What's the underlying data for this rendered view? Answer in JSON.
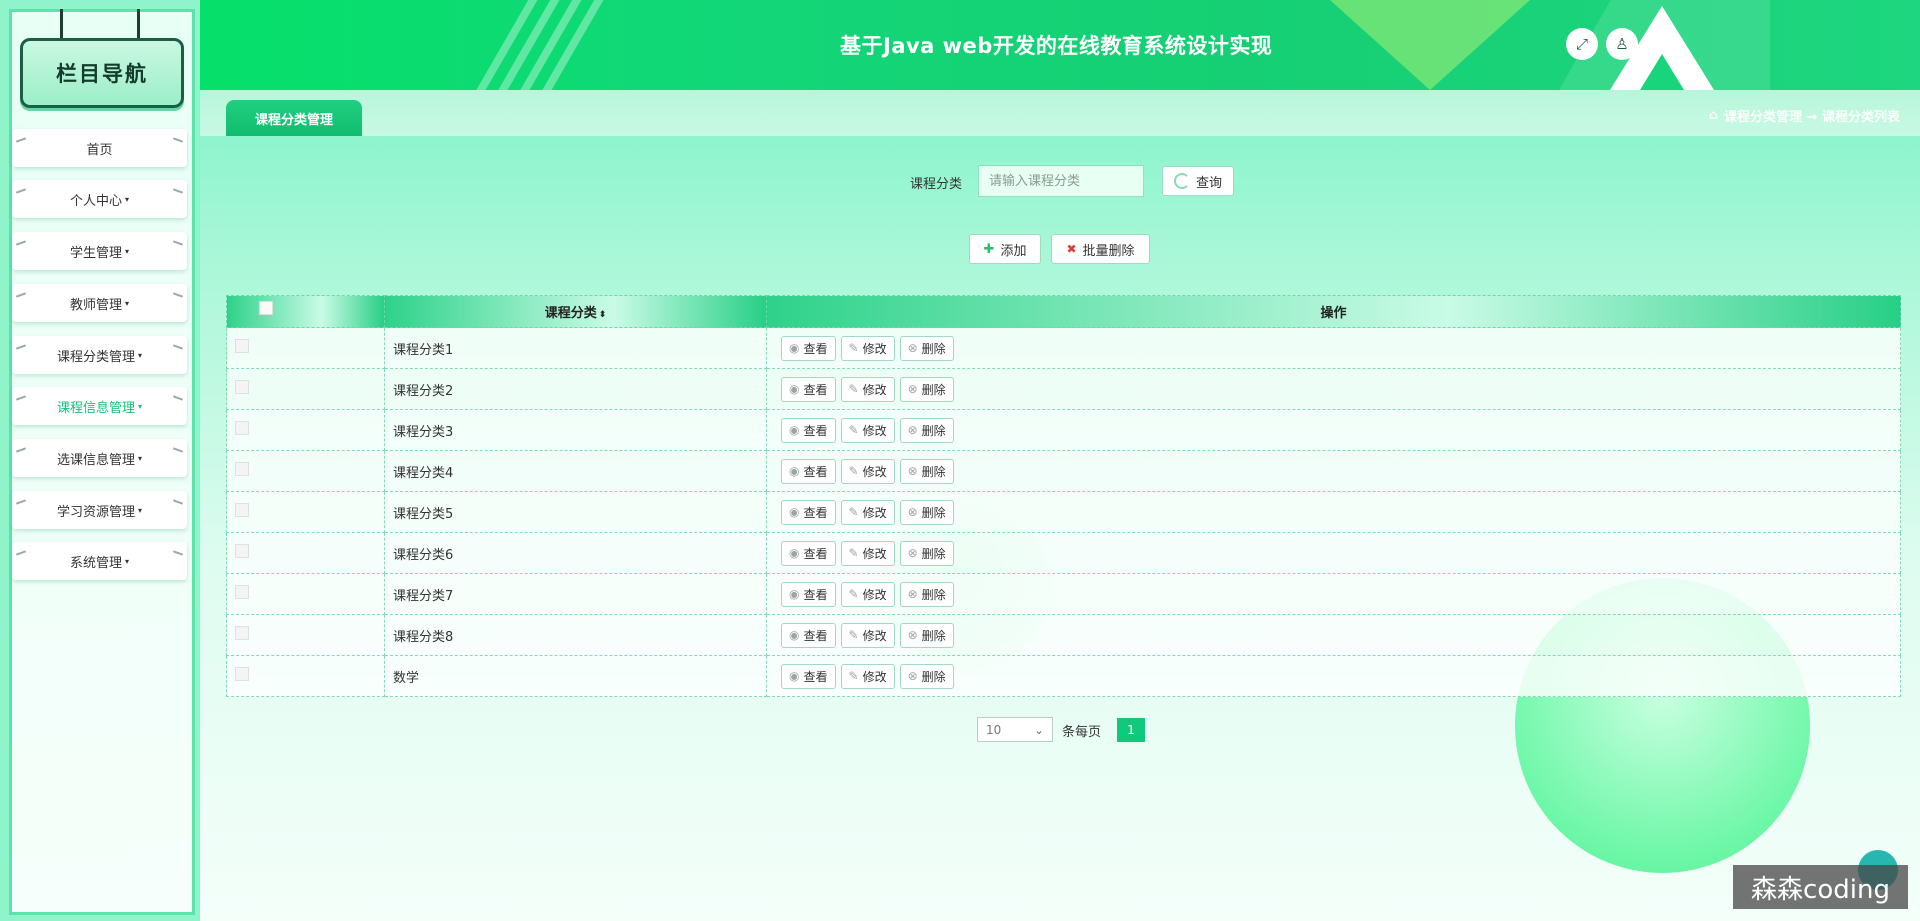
{
  "sidebar": {
    "heading": "栏目导航",
    "items": [
      {
        "label": "首页",
        "caret": ""
      },
      {
        "label": "个人中心",
        "caret": "▾"
      },
      {
        "label": "学生管理",
        "caret": "▾"
      },
      {
        "label": "教师管理",
        "caret": "▾"
      },
      {
        "label": "课程分类管理",
        "caret": "▾"
      },
      {
        "label": "课程信息管理",
        "caret": "▾"
      },
      {
        "label": "选课信息管理",
        "caret": "▾"
      },
      {
        "label": "学习资源管理",
        "caret": "▾"
      },
      {
        "label": "系统管理",
        "caret": "▾"
      }
    ]
  },
  "header": {
    "title": "基于Java web开发的在线教育系统设计实现",
    "fullscreen_icon": "⤢",
    "user_icon": "♙"
  },
  "tabs": {
    "active_tab": "课程分类管理"
  },
  "breadcrumb": {
    "home_icon": "⌂",
    "text": "课程分类管理 → 课程分类列表"
  },
  "search": {
    "label": "课程分类",
    "placeholder": "请输入课程分类",
    "button": "查询"
  },
  "actions": {
    "add": "添加",
    "add_icon": "✚",
    "batch_delete": "批量删除",
    "batch_delete_icon": "✖"
  },
  "table": {
    "columns": [
      "课程分类",
      "操作"
    ],
    "sort_icon": "⬍",
    "row_actions": {
      "view": "查看",
      "edit": "修改",
      "delete": "删除"
    },
    "row_action_icons": {
      "view": "◉",
      "edit": "✎",
      "delete": "⊗"
    },
    "rows": [
      {
        "name": "课程分类1"
      },
      {
        "name": "课程分类2"
      },
      {
        "name": "课程分类3"
      },
      {
        "name": "课程分类4"
      },
      {
        "name": "课程分类5"
      },
      {
        "name": "课程分类6"
      },
      {
        "name": "课程分类7"
      },
      {
        "name": "课程分类8"
      },
      {
        "name": "数学"
      }
    ]
  },
  "pagination": {
    "page_size": "10",
    "page_size_suffix": "条每页",
    "current_page": "1"
  },
  "watermark": "森森coding",
  "colors": {
    "accent": "#12c87c",
    "header": "#16cf74",
    "delete": "#e53939"
  }
}
